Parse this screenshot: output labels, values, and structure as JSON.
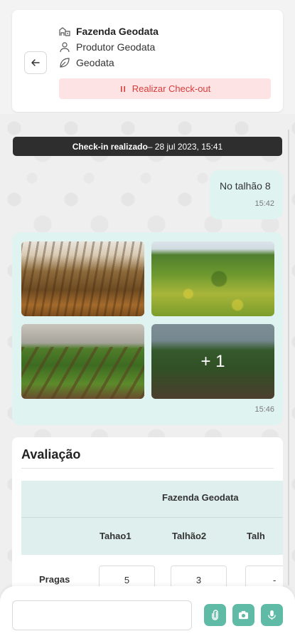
{
  "header": {
    "farm_name": "Fazenda Geodata",
    "producer": "Produtor Geodata",
    "company": "Geodata",
    "checkout_label": "Realizar Check-out"
  },
  "chat": {
    "checkin_bold": "Check-in realizado",
    "checkin_rest": " – 28 jul 2023, 15:41",
    "text_message": "No talhão 8",
    "text_time": "15:42",
    "photos_extra": "+ 1",
    "photos_time": "15:46"
  },
  "evaluation": {
    "title": "Avaliação",
    "farm": "Fazenda Geodata",
    "columns": [
      "Tahao1",
      "Talhão2",
      "Talh"
    ],
    "rows": [
      {
        "label": "Pragas",
        "values": [
          "5",
          "3",
          "-"
        ]
      }
    ]
  },
  "composer": {
    "placeholder": ""
  },
  "colors": {
    "accent": "#5fbaa6",
    "bubble": "#dff3f1",
    "danger": "#d93c3c",
    "danger_bg": "#fde3e3",
    "banner": "#2e2e2e"
  },
  "icons": {
    "back": "arrow-left-icon",
    "farm": "farm-icon",
    "producer": "user-icon",
    "company": "leaf-icon",
    "checkout": "pause-icon",
    "attach": "paperclip-icon",
    "camera": "camera-icon",
    "mic": "microphone-icon"
  }
}
